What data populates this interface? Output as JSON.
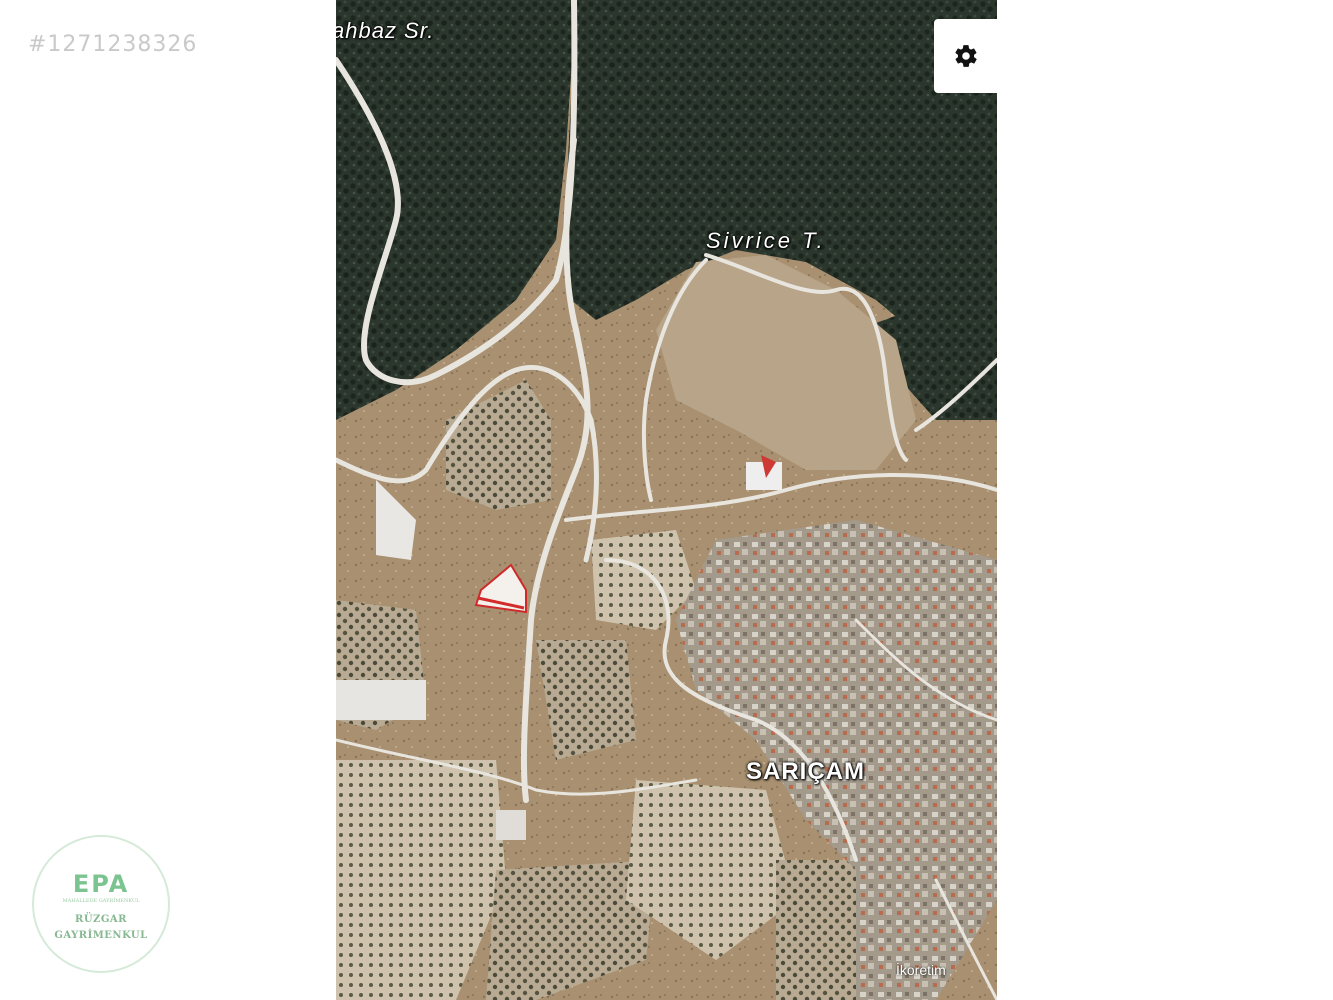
{
  "listing": {
    "id": "#1271238326"
  },
  "map": {
    "type": "satellite",
    "labels": {
      "peak_top": "ahbaz Sr.",
      "peak_center": "Sivrice T.",
      "village": "SARIÇAM",
      "attribution": "İkoretim"
    },
    "controls": {
      "settings_icon": "gear-icon"
    },
    "colors": {
      "forest": "#27332a",
      "dry_land": "#a48c6c",
      "road": "#e6e3dc",
      "parcel": "#d42a2a"
    }
  },
  "watermark": {
    "brand": "EPA",
    "tagline": "MAHALLEDE GAYRİMENKUL",
    "name_line1": "RÜZGAR",
    "name_line2": "GAYRİMENKUL"
  }
}
